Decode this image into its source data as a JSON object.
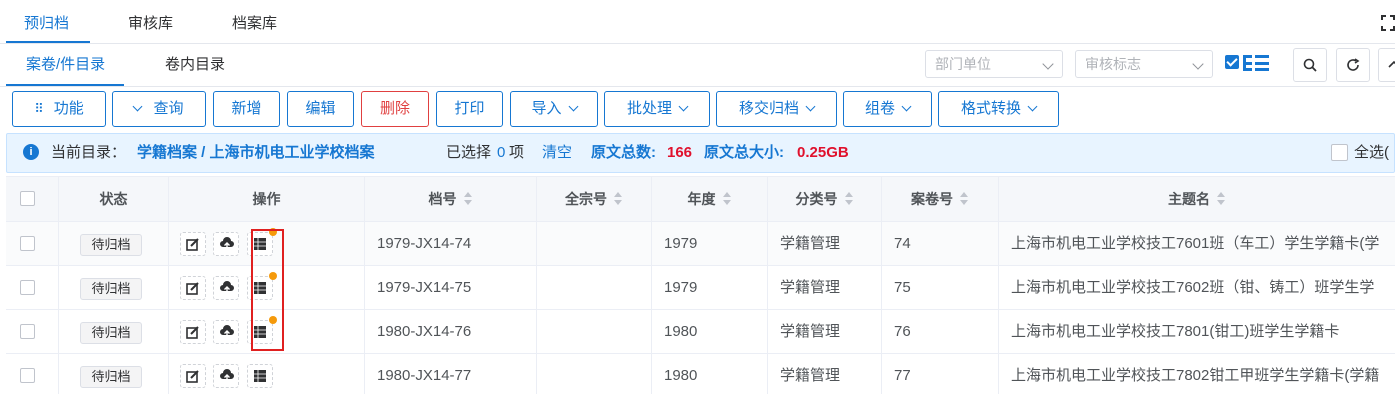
{
  "top_tabs": [
    {
      "label": "预归档",
      "active": true
    },
    {
      "label": "审核库",
      "active": false
    },
    {
      "label": "档案库",
      "active": false
    }
  ],
  "sub_tabs": [
    {
      "label": "案卷/件目录",
      "active": true
    },
    {
      "label": "卷内目录",
      "active": false
    }
  ],
  "filters": {
    "dept_placeholder": "部门单位",
    "audit_placeholder": "审核标志"
  },
  "toolbar": {
    "function_label": "功能",
    "query_label": "查询",
    "add_label": "新增",
    "edit_label": "编辑",
    "delete_label": "删除",
    "print_label": "打印",
    "import_label": "导入",
    "batch_label": "批处理",
    "transfer_label": "移交归档",
    "group_label": "组卷",
    "format_label": "格式转换"
  },
  "infobar": {
    "current_dir_label": "当前目录：",
    "current_dir_path": "学籍档案 / 上海市机电工业学校档案",
    "selected_prefix": "已选择",
    "selected_count": "0",
    "selected_suffix": "项",
    "clear_label": "清空",
    "total_count_label": "原文总数:",
    "total_count": "166",
    "total_size_label": "原文总大小:",
    "total_size": "0.25GB",
    "select_all_label": "全选("
  },
  "table": {
    "headers": {
      "status": "状态",
      "ops": "操作",
      "doc_no": "档号",
      "fonds_no": "全宗号",
      "year": "年度",
      "class_no": "分类号",
      "file_no": "案卷号",
      "title": "主题名"
    },
    "rows": [
      {
        "status": "待归档",
        "doc_no": "1979-JX14-74",
        "fonds_no": "",
        "year": "1979",
        "class_no": "学籍管理",
        "file_no": "74",
        "title": "上海市机电工业学校技工7601班（车工）学生学籍卡(学"
      },
      {
        "status": "待归档",
        "doc_no": "1979-JX14-75",
        "fonds_no": "",
        "year": "1979",
        "class_no": "学籍管理",
        "file_no": "75",
        "title": "上海市机电工业学校技工7602班（钳、铸工）班学生学"
      },
      {
        "status": "待归档",
        "doc_no": "1980-JX14-76",
        "fonds_no": "",
        "year": "1980",
        "class_no": "学籍管理",
        "file_no": "76",
        "title": "上海市机电工业学校技工7801(钳工)班学生学籍卡"
      },
      {
        "status": "待归档",
        "doc_no": "1980-JX14-77",
        "fonds_no": "",
        "year": "1980",
        "class_no": "学籍管理",
        "file_no": "77",
        "title": "上海市机电工业学校技工7802钳工甲班学生学籍卡(学籍"
      }
    ]
  },
  "colors": {
    "accent": "#1677d2",
    "danger": "#e04040",
    "highlight_box": "#e02020",
    "badge_dot": "#f59a0b"
  }
}
